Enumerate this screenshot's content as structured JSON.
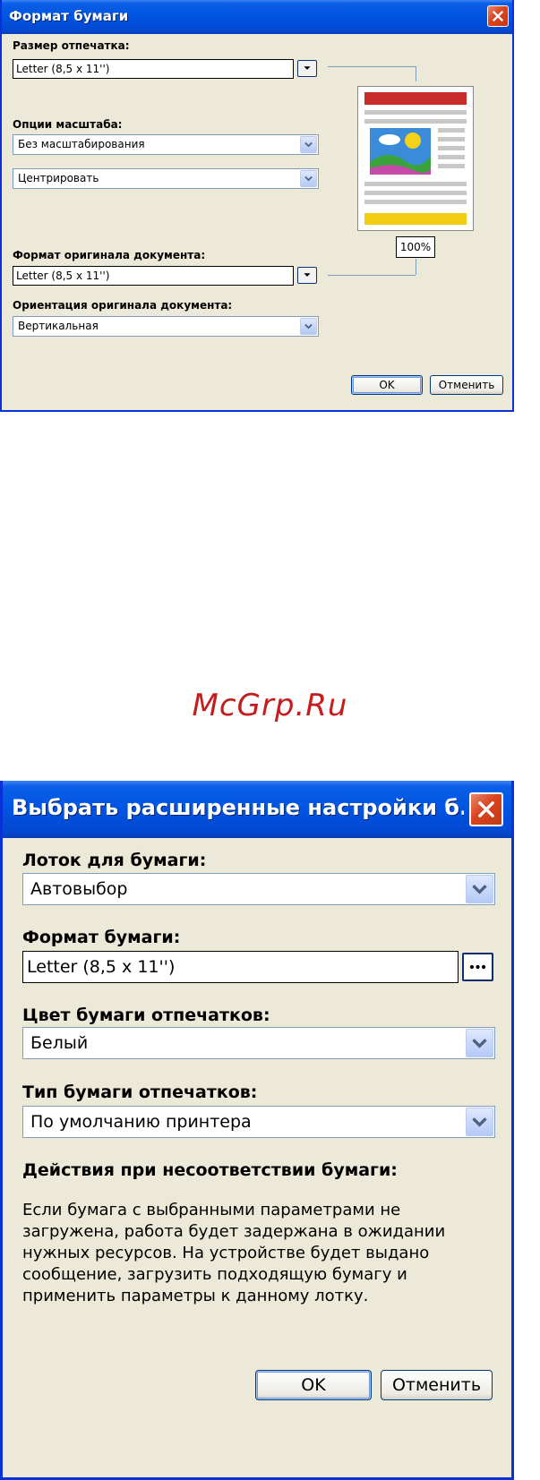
{
  "dialog1": {
    "title": "Формат бумаги",
    "print_size_label": "Размер отпечатка:",
    "print_size_value": "Letter (8,5 x 11'')",
    "scale_options_label": "Опции масштаба:",
    "scale_option_value": "Без масштабирования",
    "position_value": "Центрировать",
    "original_format_label": "Формат оригинала документа:",
    "original_format_value": "Letter (8,5 x 11'')",
    "orientation_label": "Ориентация оригинала документа:",
    "orientation_value": "Вертикальная",
    "zoom": "100%",
    "ok_label": "OK",
    "cancel_label": "Отменить"
  },
  "watermark": "McGrp.Ru",
  "dialog2": {
    "title": "Выбрать расширенные настройки б...",
    "tray_label": "Лоток для бумаги:",
    "tray_value": "Автовыбор",
    "paper_format_label": "Формат бумаги:",
    "paper_format_value": "Letter (8,5 x 11'')",
    "paper_color_label": "Цвет бумаги отпечатков:",
    "paper_color_value": "Белый",
    "paper_type_label": "Тип бумаги отпечатков:",
    "paper_type_value": "По умолчанию принтера",
    "mismatch_label": "Действия при несоответствии бумаги:",
    "mismatch_description": "Если бумага с выбранными параметрами не загружена, работа будет задержана в ожидании нужных ресурсов.  На устройстве будет выдано сообщение, загрузить подходящую бумагу и применить параметры к данному лотку.",
    "ok_label": "OK",
    "cancel_label": "Отменить"
  },
  "icons": {
    "close": "close-icon",
    "dropdown": "chevron-down-icon",
    "more": "ellipsis-icon",
    "preview": "page-preview-icon"
  },
  "colors": {
    "title_bar": "#0054e3",
    "dialog_bg": "#ece9d8",
    "close_button": "#d9441e",
    "field_border": "#7f9db9",
    "watermark": "#c41d1d"
  }
}
